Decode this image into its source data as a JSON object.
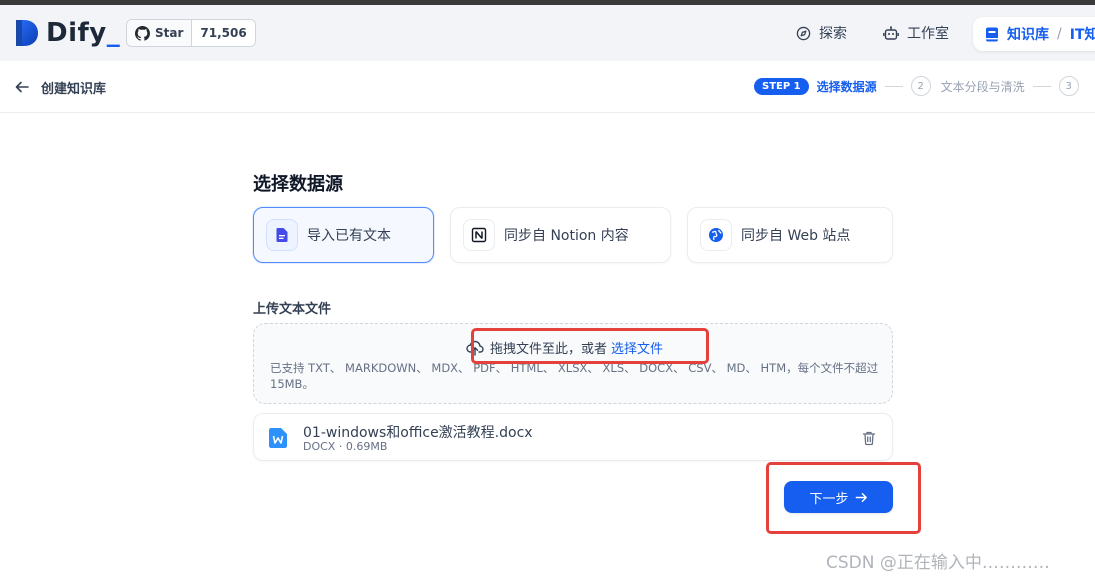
{
  "app": {
    "logo_text": "Dify",
    "logo_suffix": "_",
    "accent": "#155eef"
  },
  "github": {
    "star_label": "Star",
    "count": "71,506"
  },
  "nav": {
    "explore": "探索",
    "studio": "工作室",
    "knowledge": "知识库",
    "separator": "/",
    "current_dataset": "IT知"
  },
  "subheader": {
    "title": "创建知识库",
    "steps": [
      {
        "badge": "STEP 1",
        "label": "选择数据源"
      },
      {
        "num": "2",
        "label": "文本分段与清洗"
      },
      {
        "num": "3"
      }
    ]
  },
  "main": {
    "section_title": "选择数据源",
    "sources": [
      {
        "label": "导入已有文本",
        "icon": "file-text-icon",
        "active": true
      },
      {
        "label": "同步自 Notion 内容",
        "icon": "notion-icon",
        "active": false
      },
      {
        "label": "同步自 Web 站点",
        "icon": "globe-icon",
        "active": false
      }
    ],
    "upload_label": "上传文本文件",
    "dropzone": {
      "text": "拖拽文件至此，或者",
      "link": "选择文件",
      "hint": "已支持 TXT、 MARKDOWN、 MDX、 PDF、 HTML、 XLSX、 XLS、 DOCX、 CSV、 MD、 HTM，每个文件不超过 15MB。"
    },
    "file": {
      "name": "01-windows和office激活教程.docx",
      "meta": "DOCX · 0.69MB"
    },
    "next_button": "下一步"
  },
  "watermark": "CSDN @正在输入中…………"
}
